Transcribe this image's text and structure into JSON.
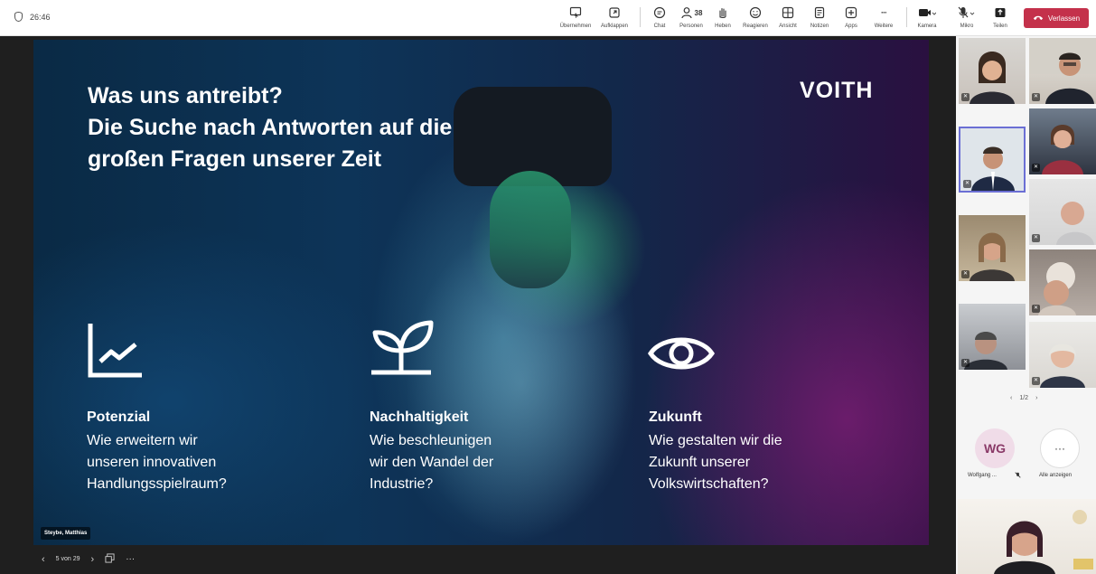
{
  "meeting": {
    "timer": "26:46"
  },
  "toolbar": {
    "takeover_label": "Übernehmen",
    "popout_label": "Aufklappen",
    "chat_label": "Chat",
    "people_label": "Personen",
    "people_count": "38",
    "raise_label": "Heben",
    "react_label": "Reagieren",
    "view_label": "Ansicht",
    "notes_label": "Notizen",
    "apps_label": "Apps",
    "more_label": "Weitere",
    "more_glyph": "···",
    "camera_label": "Kamera",
    "mic_label": "Mikro",
    "share_label": "Teilen",
    "leave_label": "Verlassen",
    "leave_color": "#c4314b"
  },
  "slide": {
    "title_line1": "Was uns antreibt?",
    "title_line2": "Die Suche nach Antworten auf die",
    "title_line3": "großen Fragen unserer Zeit",
    "logo": "VOITH",
    "columns": [
      {
        "icon": "chart-line-icon",
        "heading": "Potenzial",
        "line1": "Wie erweitern wir",
        "line2": "unseren innovativen",
        "line3": "Handlungsspielraum?"
      },
      {
        "icon": "leaf-icon",
        "heading": "Nachhaltigkeit",
        "line1": "Wie beschleunigen",
        "line2": "wir den Wandel der",
        "line3": "Industrie?"
      },
      {
        "icon": "eye-icon",
        "heading": "Zukunft",
        "line1": "Wie gestalten wir die",
        "line2": "Zukunft unserer",
        "line3": "Volkswirtschaften?"
      }
    ]
  },
  "presenter": {
    "name": "Steybe, Matthias"
  },
  "slide_nav": {
    "prev": "‹",
    "position": "5 von 29",
    "next": "›",
    "more": "···"
  },
  "gallery": {
    "page": "1/2",
    "prev": "‹",
    "next": "›",
    "tiles_count": 10,
    "muted_glyph": "✕"
  },
  "roster": {
    "initials": "WG",
    "name": "Wolfgang ...",
    "more_glyph": "···",
    "show_all_label": "Alle anzeigen"
  },
  "colors": {
    "accent": "#c4314b",
    "slide_bg": "#0d3458",
    "stage_bg": "#1f1f1f"
  }
}
